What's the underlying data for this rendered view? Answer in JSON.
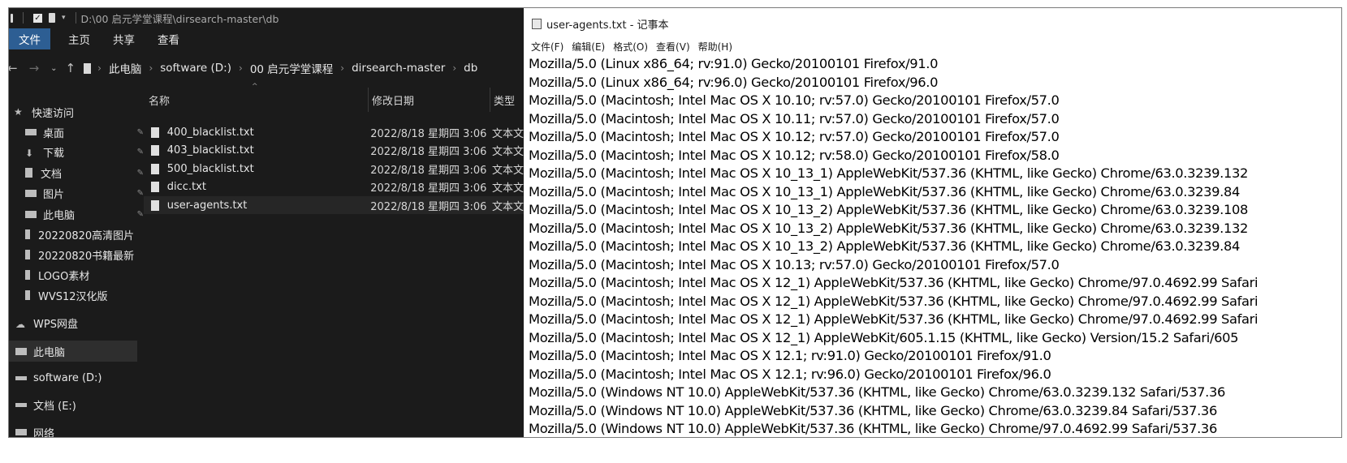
{
  "explorer": {
    "title_path": "D:\\00 启元学堂课程\\dirsearch-master\\db",
    "ribbon_tabs": [
      "文件",
      "主页",
      "共享",
      "查看"
    ],
    "breadcrumbs": [
      "此电脑",
      "software (D:)",
      "00 启元学堂课程",
      "dirsearch-master",
      "db"
    ],
    "columns": {
      "name": "名称",
      "date": "修改日期",
      "type": "类型"
    },
    "sidebar": [
      {
        "label": "快速访问",
        "icon": "star-icon"
      },
      {
        "label": "桌面",
        "icon": "desktop-icon",
        "pinned": true
      },
      {
        "label": "下载",
        "icon": "download-icon",
        "pinned": true
      },
      {
        "label": "文档",
        "icon": "document-icon",
        "pinned": true
      },
      {
        "label": "图片",
        "icon": "picture-icon",
        "pinned": true
      },
      {
        "label": "此电脑",
        "icon": "computer-icon",
        "pinned": true
      },
      {
        "label": "20220820高清图片",
        "icon": "folder-icon"
      },
      {
        "label": "20220820书籍最新",
        "icon": "folder-icon"
      },
      {
        "label": "LOGO素材",
        "icon": "folder-icon"
      },
      {
        "label": "WVS12汉化版",
        "icon": "folder-icon"
      },
      {
        "label": "WPS网盘",
        "icon": "cloud-icon"
      },
      {
        "label": "此电脑",
        "icon": "computer-icon",
        "selected": true
      },
      {
        "label": "software (D:)",
        "icon": "drive-icon"
      },
      {
        "label": "文档 (E:)",
        "icon": "drive-icon"
      },
      {
        "label": "网络",
        "icon": "network-icon"
      }
    ],
    "files": [
      {
        "name": "400_blacklist.txt",
        "date": "2022/8/18 星期四 3:06",
        "type": "文本文"
      },
      {
        "name": "403_blacklist.txt",
        "date": "2022/8/18 星期四 3:06",
        "type": "文本文"
      },
      {
        "name": "500_blacklist.txt",
        "date": "2022/8/18 星期四 3:06",
        "type": "文本文"
      },
      {
        "name": "dicc.txt",
        "date": "2022/8/18 星期四 3:06",
        "type": "文本文"
      },
      {
        "name": "user-agents.txt",
        "date": "2022/8/18 星期四 3:06",
        "type": "文本文",
        "selected": true
      }
    ]
  },
  "notepad": {
    "title": "user-agents.txt - 记事本",
    "menu": [
      "文件(F)",
      "编辑(E)",
      "格式(O)",
      "查看(V)",
      "帮助(H)"
    ],
    "lines": [
      "Mozilla/5.0 (Linux x86_64; rv:91.0) Gecko/20100101 Firefox/91.0",
      "Mozilla/5.0 (Linux x86_64; rv:96.0) Gecko/20100101 Firefox/96.0",
      "Mozilla/5.0 (Macintosh; Intel Mac OS X 10.10; rv:57.0) Gecko/20100101 Firefox/57.0",
      "Mozilla/5.0 (Macintosh; Intel Mac OS X 10.11; rv:57.0) Gecko/20100101 Firefox/57.0",
      "Mozilla/5.0 (Macintosh; Intel Mac OS X 10.12; rv:57.0) Gecko/20100101 Firefox/57.0",
      "Mozilla/5.0 (Macintosh; Intel Mac OS X 10.12; rv:58.0) Gecko/20100101 Firefox/58.0",
      "Mozilla/5.0 (Macintosh; Intel Mac OS X 10_13_1) AppleWebKit/537.36 (KHTML, like Gecko) Chrome/63.0.3239.132",
      "Mozilla/5.0 (Macintosh; Intel Mac OS X 10_13_1) AppleWebKit/537.36 (KHTML, like Gecko) Chrome/63.0.3239.84",
      "Mozilla/5.0 (Macintosh; Intel Mac OS X 10_13_2) AppleWebKit/537.36 (KHTML, like Gecko) Chrome/63.0.3239.108",
      "Mozilla/5.0 (Macintosh; Intel Mac OS X 10_13_2) AppleWebKit/537.36 (KHTML, like Gecko) Chrome/63.0.3239.132",
      "Mozilla/5.0 (Macintosh; Intel Mac OS X 10_13_2) AppleWebKit/537.36 (KHTML, like Gecko) Chrome/63.0.3239.84",
      "Mozilla/5.0 (Macintosh; Intel Mac OS X 10.13; rv:57.0) Gecko/20100101 Firefox/57.0",
      "Mozilla/5.0 (Macintosh; Intel Mac OS X 12_1) AppleWebKit/537.36 (KHTML, like Gecko) Chrome/97.0.4692.99 Safari",
      "Mozilla/5.0 (Macintosh; Intel Mac OS X 12_1) AppleWebKit/537.36 (KHTML, like Gecko) Chrome/97.0.4692.99 Safari",
      "Mozilla/5.0 (Macintosh; Intel Mac OS X 12_1) AppleWebKit/537.36 (KHTML, like Gecko) Chrome/97.0.4692.99 Safari",
      "Mozilla/5.0 (Macintosh; Intel Mac OS X 12_1) AppleWebKit/605.1.15 (KHTML, like Gecko) Version/15.2 Safari/605",
      "Mozilla/5.0 (Macintosh; Intel Mac OS X 12.1; rv:91.0) Gecko/20100101 Firefox/91.0",
      "Mozilla/5.0 (Macintosh; Intel Mac OS X 12.1; rv:96.0) Gecko/20100101 Firefox/96.0",
      "Mozilla/5.0 (Windows NT 10.0) AppleWebKit/537.36 (KHTML, like Gecko) Chrome/63.0.3239.132 Safari/537.36",
      "Mozilla/5.0 (Windows NT 10.0) AppleWebKit/537.36 (KHTML, like Gecko) Chrome/63.0.3239.84 Safari/537.36",
      "Mozilla/5.0 (Windows NT 10.0) AppleWebKit/537.36 (KHTML, like Gecko) Chrome/97.0.4692.99 Safari/537.36"
    ]
  }
}
